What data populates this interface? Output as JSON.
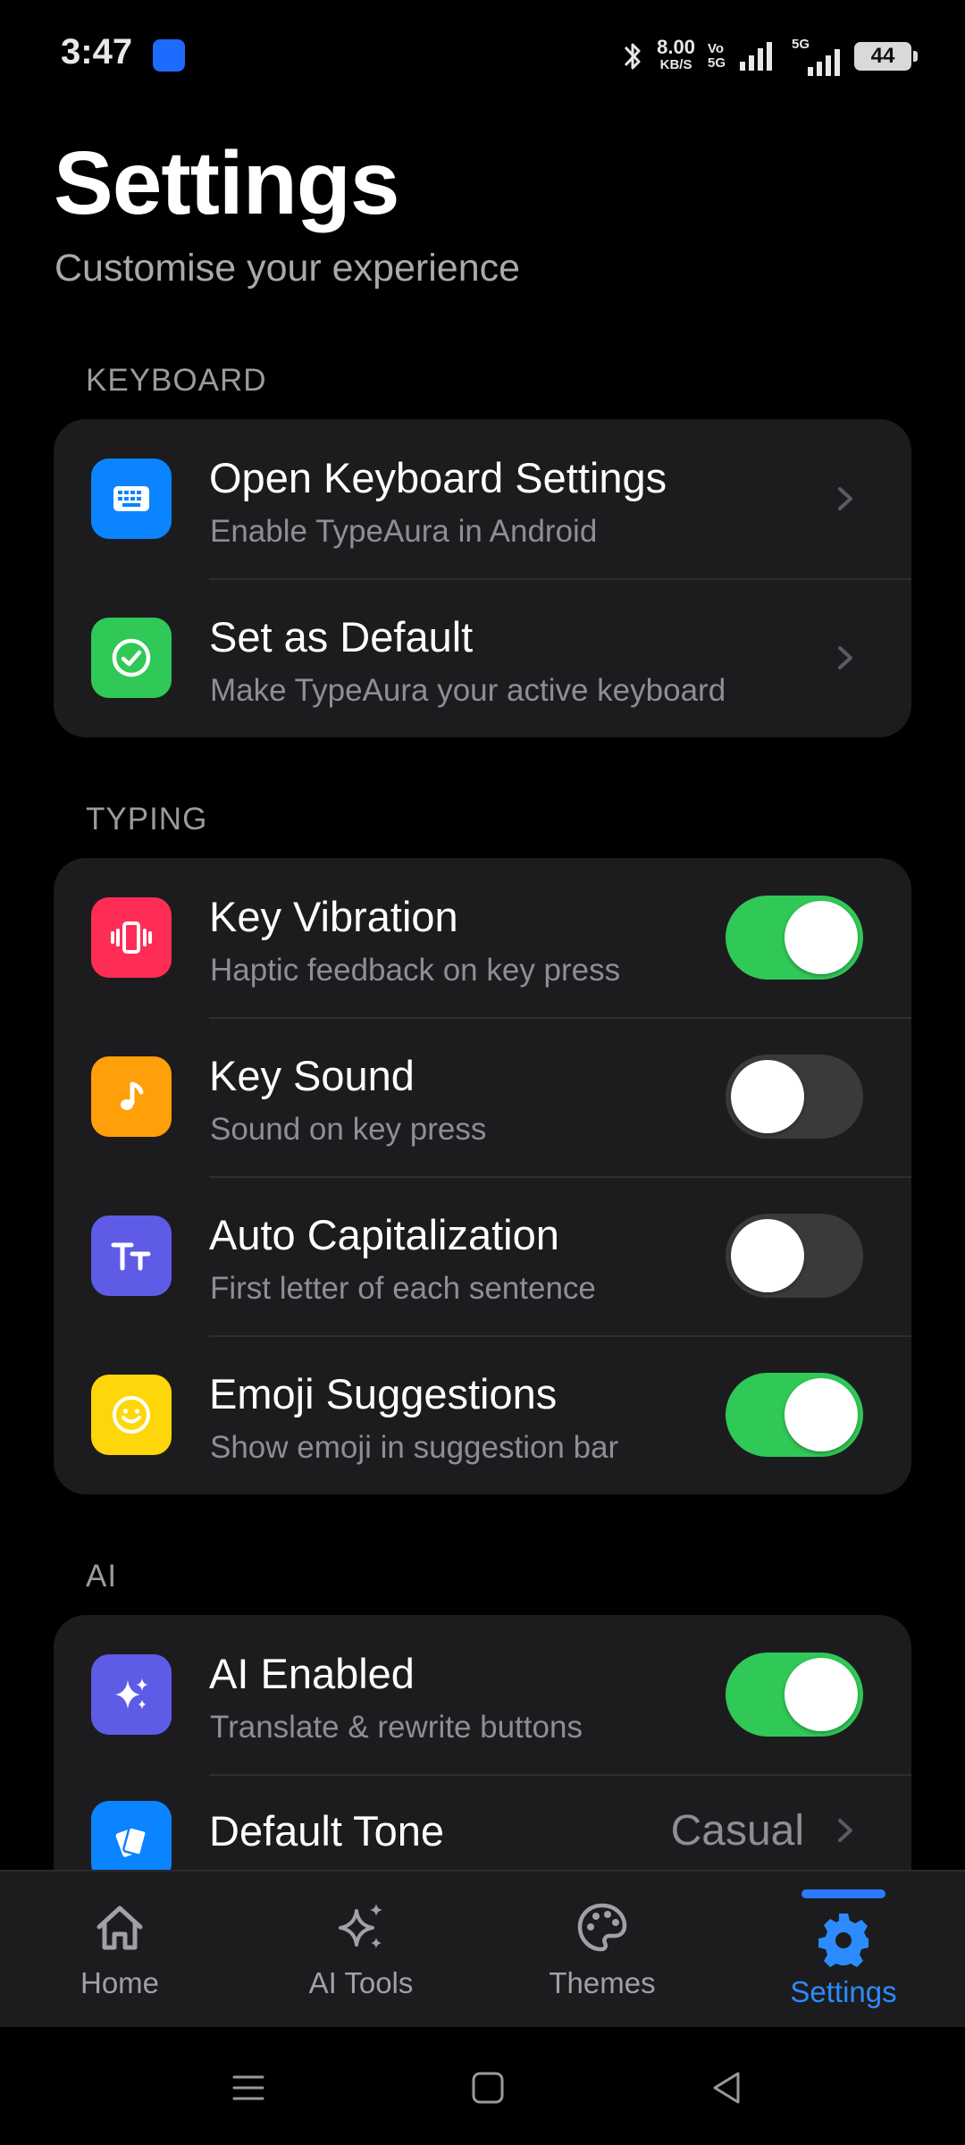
{
  "status_bar": {
    "time": "3:47",
    "speed_value": "8.00",
    "speed_unit": "KB/S",
    "volte_top": "Vo",
    "volte_bottom": "5G",
    "network_label": "5G",
    "battery": "44"
  },
  "header": {
    "title": "Settings",
    "subtitle": "Customise your experience"
  },
  "sections": {
    "keyboard": {
      "label": "KEYBOARD",
      "items": [
        {
          "title": "Open Keyboard Settings",
          "subtitle": "Enable TypeAura in Android",
          "icon": "keyboard-icon",
          "color": "#0a84ff"
        },
        {
          "title": "Set as Default",
          "subtitle": "Make TypeAura your active keyboard",
          "icon": "check-circle-icon",
          "color": "#30c857"
        }
      ]
    },
    "typing": {
      "label": "TYPING",
      "items": [
        {
          "title": "Key Vibration",
          "subtitle": "Haptic feedback on key press",
          "icon": "vibration-icon",
          "color": "#ff2d55",
          "toggle": true
        },
        {
          "title": "Key Sound",
          "subtitle": "Sound on key press",
          "icon": "music-note-icon",
          "color": "#ff9f0a",
          "toggle": false
        },
        {
          "title": "Auto Capitalization",
          "subtitle": "First letter of each sentence",
          "icon": "text-case-icon",
          "color": "#5e5ce6",
          "toggle": false
        },
        {
          "title": "Emoji Suggestions",
          "subtitle": "Show emoji in suggestion bar",
          "icon": "smiley-icon",
          "color": "#ffd60a",
          "toggle": true
        }
      ]
    },
    "ai": {
      "label": "AI",
      "items": [
        {
          "title": "AI Enabled",
          "subtitle": "Translate & rewrite buttons",
          "icon": "sparkles-icon",
          "color": "#5e5ce6",
          "toggle": true
        },
        {
          "title": "Default Tone",
          "value": "Casual",
          "icon": "cards-icon",
          "color": "#0a84ff"
        }
      ]
    }
  },
  "bottom_nav": {
    "items": [
      {
        "label": "Home",
        "icon": "home-icon"
      },
      {
        "label": "AI Tools",
        "icon": "sparkles-icon"
      },
      {
        "label": "Themes",
        "icon": "palette-icon"
      },
      {
        "label": "Settings",
        "icon": "gear-icon",
        "active": true
      }
    ]
  },
  "colors": {
    "background": "#000000",
    "card": "#1c1c1e",
    "accent_blue": "#2b8bff",
    "toggle_on": "#30c857",
    "toggle_off": "#3a3a3d"
  }
}
